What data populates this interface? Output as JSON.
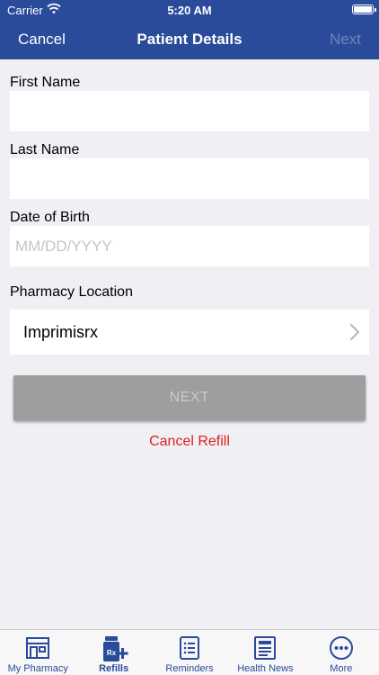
{
  "status_bar": {
    "carrier": "Carrier",
    "time": "5:20 AM"
  },
  "nav": {
    "cancel_label": "Cancel",
    "title": "Patient Details",
    "next_label": "Next"
  },
  "form": {
    "first_name_label": "First Name",
    "first_name_value": "",
    "last_name_label": "Last Name",
    "last_name_value": "",
    "dob_label": "Date of Birth",
    "dob_placeholder": "MM/DD/YYYY",
    "pharmacy_label": "Pharmacy Location",
    "pharmacy_value": "Imprimisrx"
  },
  "actions": {
    "next_button_label": "NEXT",
    "cancel_refill_label": "Cancel Refill"
  },
  "tabs": [
    {
      "label": "My Pharmacy",
      "icon": "store-icon"
    },
    {
      "label": "Refills",
      "icon": "rx-bottle-icon",
      "active": true
    },
    {
      "label": "Reminders",
      "icon": "checklist-icon"
    },
    {
      "label": "Health News",
      "icon": "newspaper-icon"
    },
    {
      "label": "More",
      "icon": "more-dots-icon"
    }
  ],
  "colors": {
    "primary": "#2a4a9a",
    "background": "#efeff4",
    "danger": "#e02020",
    "disabled_button": "#9e9e9e"
  }
}
